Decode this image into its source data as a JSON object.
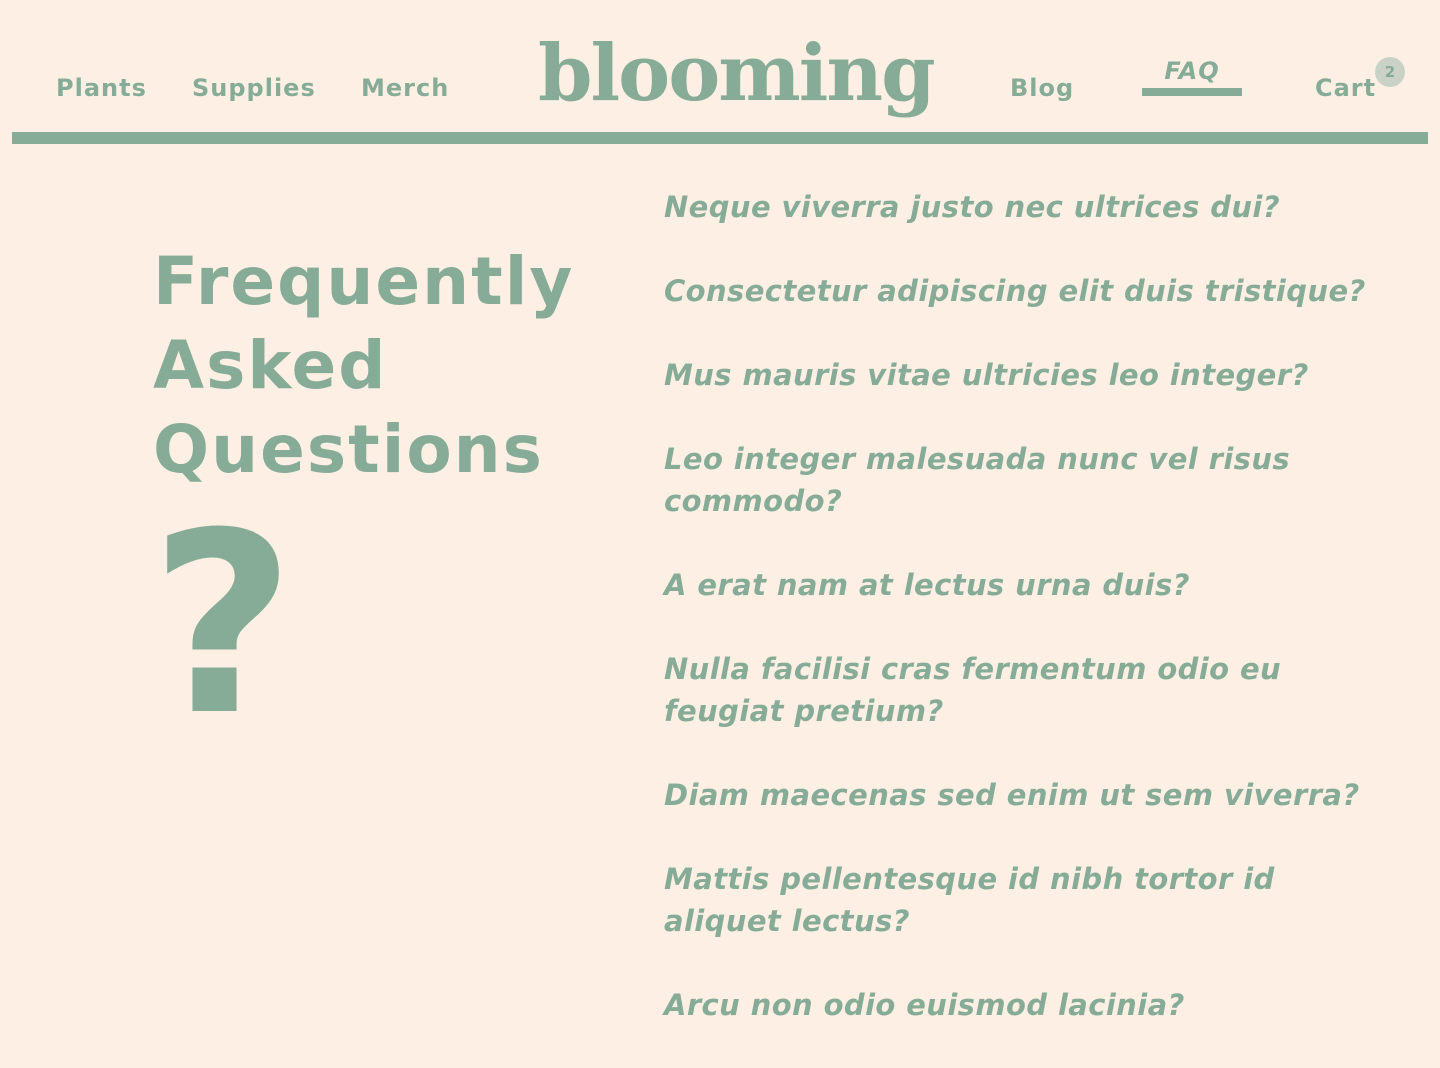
{
  "header": {
    "logo": "blooming",
    "nav_left": [
      {
        "label": "Plants"
      },
      {
        "label": "Supplies"
      },
      {
        "label": "Merch"
      }
    ],
    "nav_right": {
      "blog": "Blog",
      "faq": "FAQ",
      "cart": "Cart",
      "cart_count": "2"
    },
    "active_nav": "FAQ"
  },
  "main": {
    "title_lines": [
      "Frequently",
      "Asked",
      "Questions"
    ],
    "icon": "question-mark-icon",
    "questions": [
      "Neque viverra justo nec ultrices dui?",
      "Consectetur adipiscing elit duis tristique?",
      "Mus mauris vitae ultricies leo integer?",
      "Leo integer malesuada nunc vel risus commodo?",
      "A erat nam at lectus urna duis?",
      "Nulla facilisi cras fermentum odio eu feugiat pretium?",
      "Diam maecenas sed enim ut sem viverra?",
      "Mattis pellentesque id nibh tortor id aliquet lectus?",
      "Arcu non odio euismod lacinia?"
    ]
  },
  "colors": {
    "background": "#FDEFE3",
    "accent": "#86AC98",
    "badge": "#C9D2C4"
  }
}
